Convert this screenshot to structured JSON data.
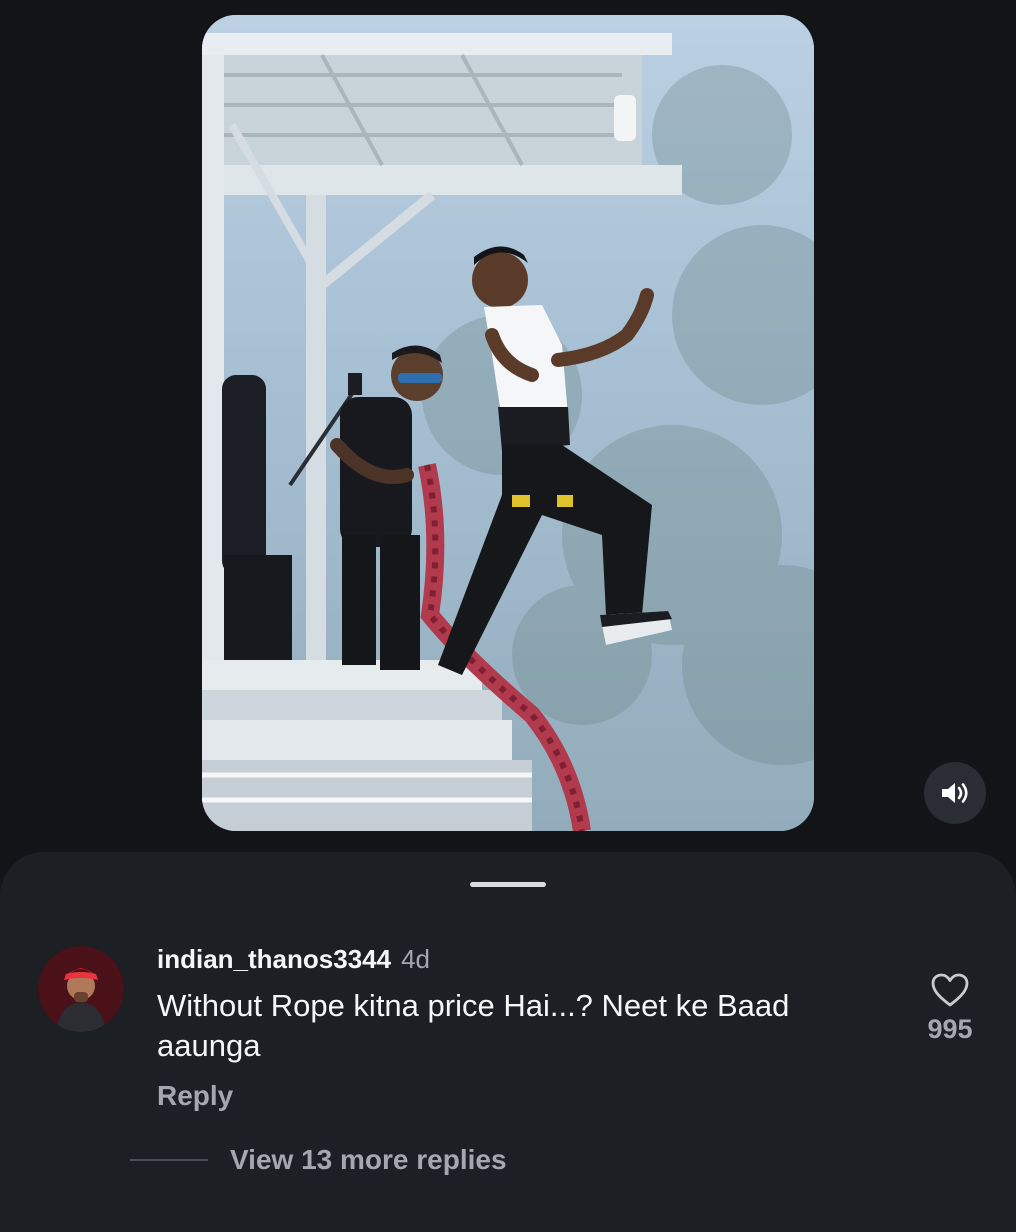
{
  "video": {
    "sound_icon": "speaker-volume-icon"
  },
  "comment": {
    "username": "indian_thanos3344",
    "timestamp": "4d",
    "text": "Without Rope kitna price Hai...? Neet ke Baad aaunga",
    "reply_label": "Reply",
    "like_count": "995",
    "like_icon": "heart-outline-icon"
  },
  "replies": {
    "view_more_label": "View 13 more replies"
  },
  "colors": {
    "background": "#121418",
    "sheet": "#1c1f24",
    "primary_text": "#f5f6f7",
    "secondary_text": "#a4a8ae"
  }
}
